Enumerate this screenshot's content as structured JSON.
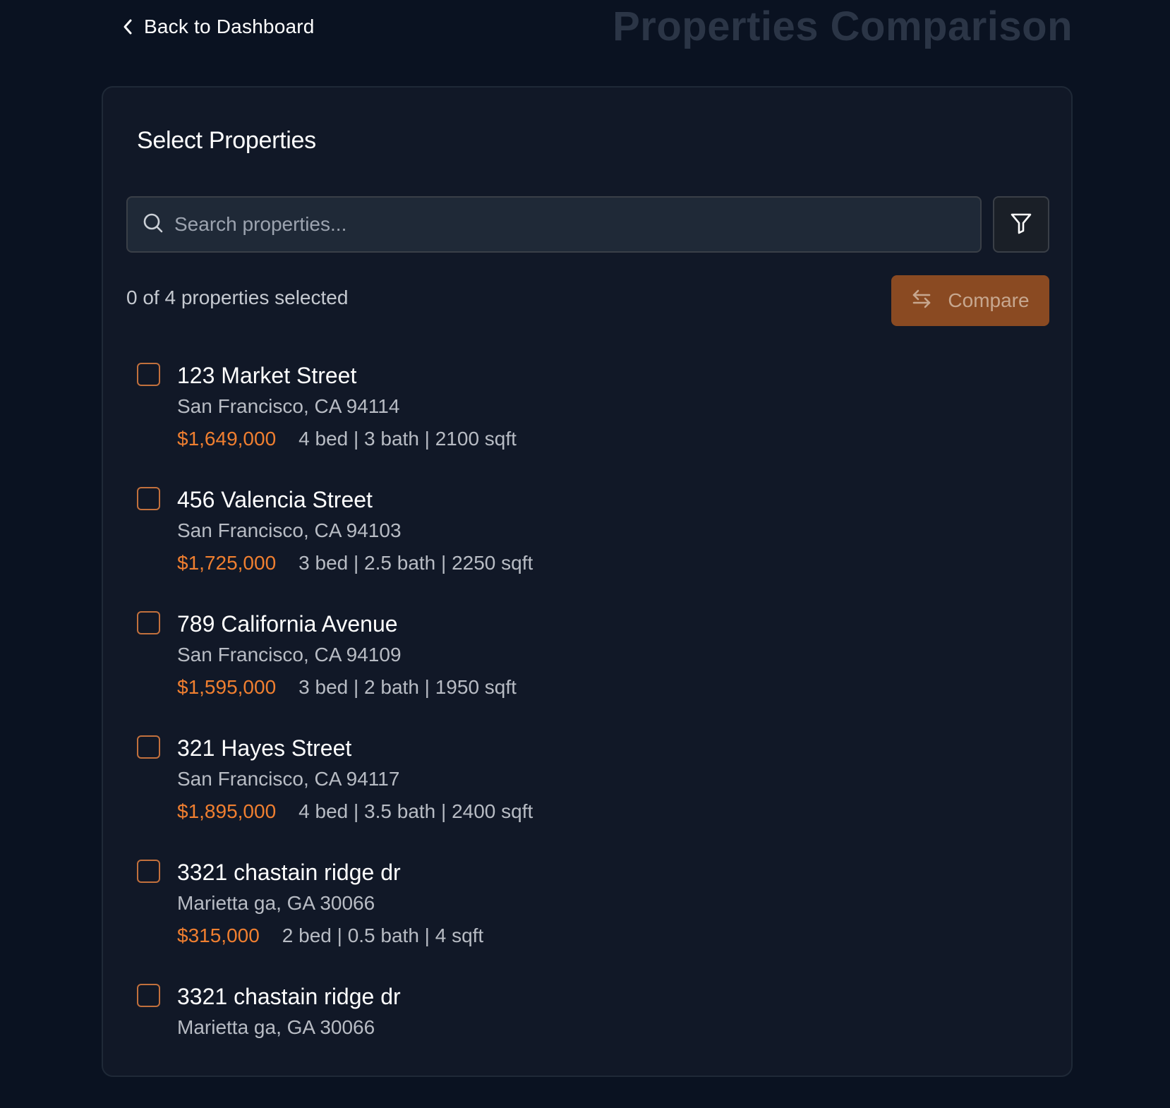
{
  "nav": {
    "back_label": "Back to Dashboard"
  },
  "header": {
    "title": "Properties Comparison"
  },
  "card": {
    "title": "Select Properties"
  },
  "search": {
    "placeholder": "Search properties...",
    "value": ""
  },
  "selection": {
    "count_text": "0 of 4 properties selected"
  },
  "actions": {
    "compare_label": "Compare"
  },
  "colors": {
    "accent": "#f07f30",
    "compare_button_disabled": "#8a4a22",
    "background": "#0a1221",
    "card": "#111827"
  },
  "properties": [
    {
      "name": "123 Market Street",
      "location": "San Francisco, CA 94114",
      "price": "$1,649,000",
      "specs": "4 bed | 3 bath | 2100 sqft",
      "checked": false
    },
    {
      "name": "456 Valencia Street",
      "location": "San Francisco, CA 94103",
      "price": "$1,725,000",
      "specs": "3 bed | 2.5 bath | 2250 sqft",
      "checked": false
    },
    {
      "name": "789 California Avenue",
      "location": "San Francisco, CA 94109",
      "price": "$1,595,000",
      "specs": "3 bed | 2 bath | 1950 sqft",
      "checked": false
    },
    {
      "name": "321 Hayes Street",
      "location": "San Francisco, CA 94117",
      "price": "$1,895,000",
      "specs": "4 bed | 3.5 bath | 2400 sqft",
      "checked": false
    },
    {
      "name": "3321 chastain ridge dr",
      "location": "Marietta ga, GA 30066",
      "price": "$315,000",
      "specs": "2 bed | 0.5 bath | 4 sqft",
      "checked": false
    },
    {
      "name": "3321 chastain ridge dr",
      "location": "Marietta ga, GA 30066",
      "checked": false
    }
  ]
}
